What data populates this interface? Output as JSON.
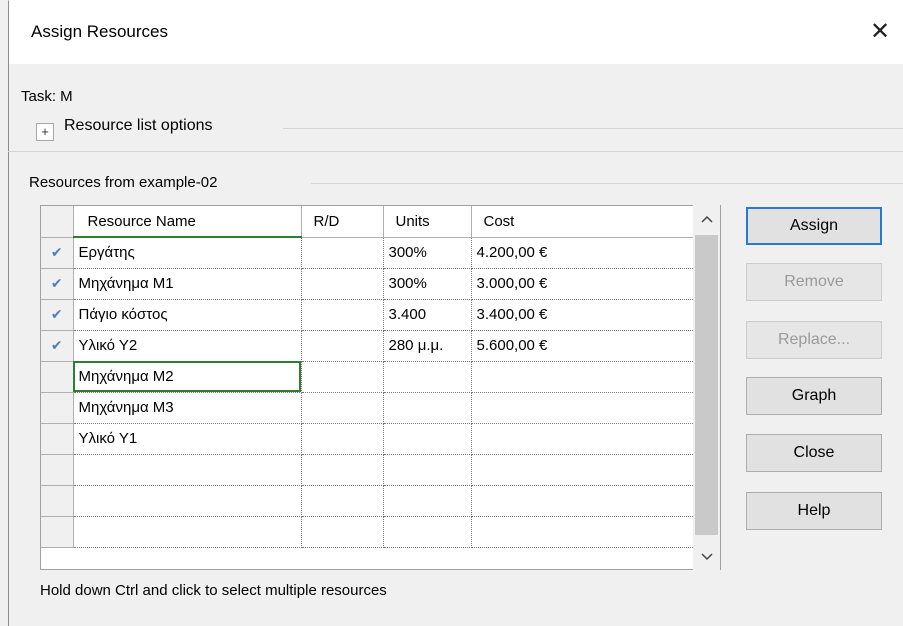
{
  "dialog": {
    "title": "Assign Resources",
    "close_glyph": "✕",
    "task_label": "Task: M",
    "resource_list_options": {
      "toggle_glyph": "+",
      "label": "Resource list options"
    },
    "resources_from": "Resources from example-02",
    "table": {
      "columns": [
        "Resource Name",
        "R/D",
        "Units",
        "Cost"
      ],
      "rows": [
        {
          "assigned": true,
          "check": "✔",
          "name": "Εργάτης",
          "rd": "",
          "units": "300%",
          "cost": "4.200,00 €"
        },
        {
          "assigned": true,
          "check": "✔",
          "name": "Μηχάνημα M1",
          "rd": "",
          "units": "300%",
          "cost": "3.000,00 €"
        },
        {
          "assigned": true,
          "check": "✔",
          "name": "Πάγιο κόστος",
          "rd": "",
          "units": "3.400",
          "cost": "3.400,00 €"
        },
        {
          "assigned": true,
          "check": "✔",
          "name": "Υλικό Υ2",
          "rd": "",
          "units": "280 μ.μ.",
          "cost": "5.600,00 €"
        },
        {
          "assigned": false,
          "check": "",
          "name": "Μηχάνημα M2",
          "rd": "",
          "units": "",
          "cost": ""
        },
        {
          "assigned": false,
          "check": "",
          "name": "Μηχάνημα M3",
          "rd": "",
          "units": "",
          "cost": ""
        },
        {
          "assigned": false,
          "check": "",
          "name": "Υλικό Υ1",
          "rd": "",
          "units": "",
          "cost": ""
        },
        {
          "assigned": false,
          "check": "",
          "name": "",
          "rd": "",
          "units": "",
          "cost": ""
        },
        {
          "assigned": false,
          "check": "",
          "name": "",
          "rd": "",
          "units": "",
          "cost": ""
        },
        {
          "assigned": false,
          "check": "",
          "name": "",
          "rd": "",
          "units": "",
          "cost": ""
        }
      ],
      "active_row": 4,
      "scroll_up_glyph": "^",
      "scroll_down_glyph": "v"
    },
    "buttons": {
      "assign": "Assign",
      "remove": "Remove",
      "replace": "Replace...",
      "graph": "Graph",
      "close": "Close",
      "help": "Help"
    },
    "hint": "Hold down Ctrl and click to select multiple resources"
  },
  "colors": {
    "check": "#4a7fc0",
    "active_cell": "#2e7d32",
    "default_button_border": "#2a78d0"
  }
}
